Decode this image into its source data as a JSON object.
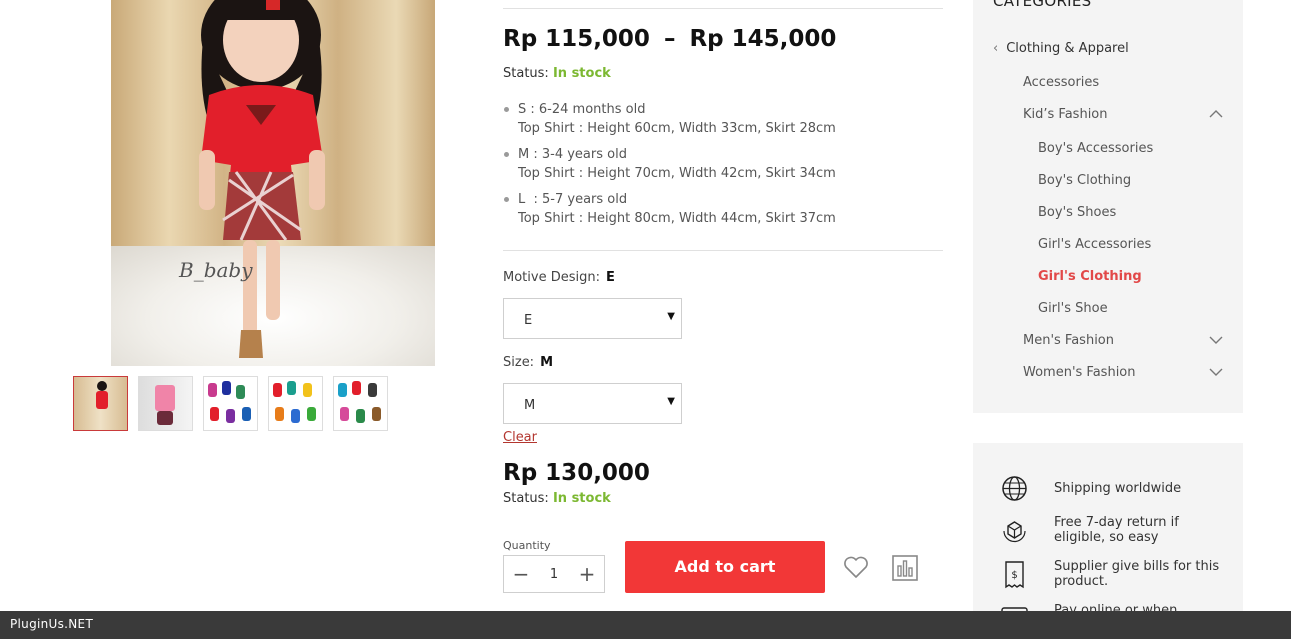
{
  "gallery": {
    "watermark": "B_baby",
    "thumbnails": [
      {
        "label": "red-kebaya"
      },
      {
        "label": "pink-kebaya"
      },
      {
        "label": "color-variants-1"
      },
      {
        "label": "color-variants-2"
      },
      {
        "label": "color-variants-3"
      }
    ]
  },
  "product": {
    "price_min": "Rp 115,000",
    "price_max": "Rp 145,000",
    "range_dash": "–",
    "status_label": "Status:",
    "status_value": "In stock",
    "sizes": [
      {
        "title": "S : 6-24 months old",
        "detail": "Top Shirt : Height 60cm, Width 33cm, Skirt 28cm"
      },
      {
        "title": "M : 3-4 years old",
        "detail": "Top Shirt : Height 70cm, Width 42cm, Skirt 34cm"
      },
      {
        "title": "L  : 5-7 years old",
        "detail": "Top Shirt : Height 80cm, Width 44cm, Skirt 37cm"
      }
    ],
    "motive_label": "Motive Design:",
    "motive_value": "E",
    "motive_select": "E",
    "size_label": "Size:",
    "size_value": "M",
    "size_select": "M",
    "clear_label": "Clear",
    "variation_price": "Rp 130,000",
    "variation_status_label": "Status:",
    "variation_status_value": "In stock",
    "quantity_label": "Quantity",
    "quantity_value": "1",
    "add_to_cart": "Add to cart"
  },
  "sidebar": {
    "title": "CATEGORIES",
    "parent": "Clothing & Apparel",
    "items": [
      {
        "label": "Accessories"
      },
      {
        "label": "Kid’s Fashion"
      },
      {
        "label": "Boy's Accessories"
      },
      {
        "label": "Boy's Clothing"
      },
      {
        "label": "Boy's Shoes"
      },
      {
        "label": "Girl's Accessories"
      },
      {
        "label": "Girl's Clothing"
      },
      {
        "label": "Girl's Shoe"
      },
      {
        "label": "Men's Fashion"
      },
      {
        "label": "Women's Fashion"
      }
    ],
    "shipping": [
      {
        "icon": "globe-icon",
        "text": "Shipping worldwide"
      },
      {
        "icon": "box-return-icon",
        "text": "Free 7-day return if eligible, so easy"
      },
      {
        "icon": "receipt-icon",
        "text": "Supplier give bills for this product."
      },
      {
        "icon": "card-icon",
        "text": "Pay online or when"
      }
    ]
  },
  "footer": {
    "brand": "PluginUs.NET"
  },
  "colors": {
    "accent": "#f23737",
    "in_stock": "#7cb832",
    "current_category": "#e24848",
    "footer_bg": "#3a3a3a"
  }
}
